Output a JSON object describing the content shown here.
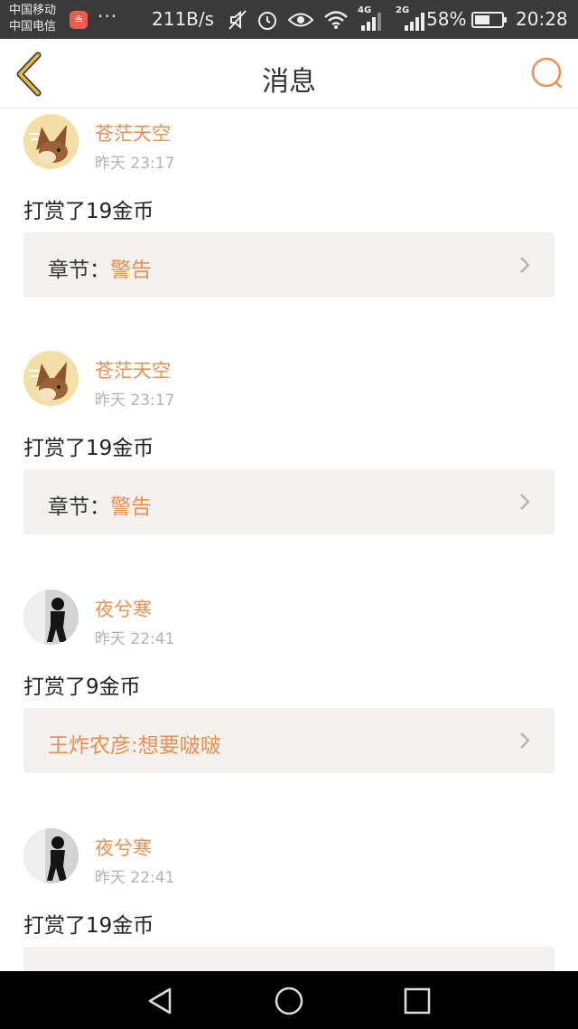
{
  "status_bar": {
    "carrier_1": "中国移动",
    "carrier_2": "中国电信",
    "app_badge": "≗",
    "more": "···",
    "net_speed": "211B/s",
    "net_type_1": "4G",
    "net_type_2": "2G",
    "battery_percent": "58%",
    "battery_level": 0.58,
    "time": "20:28"
  },
  "header": {
    "title": "消息"
  },
  "colors": {
    "accent": "#f08d50",
    "back_arrow": "#e8b93b"
  },
  "messages": [
    {
      "username": "苍茫天空",
      "time": "昨天 23:17",
      "text": "打赏了19金币",
      "ref_prefix": "章节：",
      "ref_value": "警告",
      "avatar": "fox-avatar"
    },
    {
      "username": "苍茫天空",
      "time": "昨天 23:17",
      "text": "打赏了19金币",
      "ref_prefix": "章节：",
      "ref_value": "警告",
      "avatar": "fox-avatar"
    },
    {
      "username": "夜兮寒",
      "time": "昨天 22:41",
      "text": "打赏了9金币",
      "ref_prefix": "",
      "ref_value": "王炸农彦:想要啵啵",
      "avatar": "person-avatar"
    },
    {
      "username": "夜兮寒",
      "time": "昨天 22:41",
      "text": "打赏了19金币",
      "avatar": "person-avatar"
    }
  ],
  "nav_bar": {
    "back": "back-triangle-icon",
    "home": "home-circle-icon",
    "recents": "recents-square-icon"
  }
}
